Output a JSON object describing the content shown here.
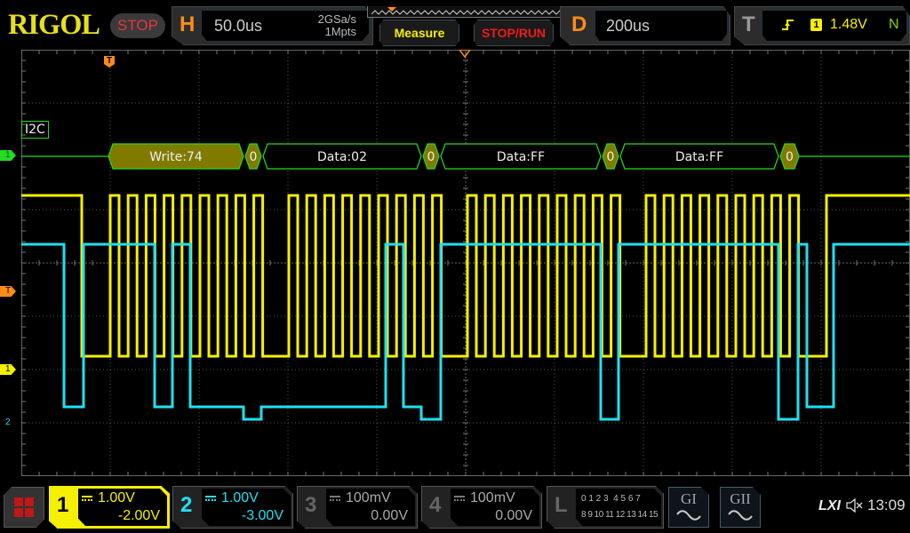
{
  "header": {
    "brand": "RIGOL",
    "run_state": "STOP",
    "horizontal": {
      "letter": "H",
      "timebase": "50.0us",
      "sample_rate": "2GSa/s",
      "memory_depth": "1Mpts"
    },
    "measure_label": "Measure",
    "stop_run_label": "STOP/RUN",
    "delay": {
      "letter": "D",
      "value": "200us"
    },
    "trigger": {
      "letter": "T",
      "edge": "rising-edge-icon",
      "source": "1",
      "level": "1.48V",
      "mode": "N"
    }
  },
  "decoder": {
    "label": "I2C",
    "packets": [
      {
        "text": "Write:74",
        "type": "address"
      },
      {
        "text": "0",
        "type": "ack"
      },
      {
        "text": "Data:02",
        "type": "data"
      },
      {
        "text": "0",
        "type": "ack"
      },
      {
        "text": "Data:FF",
        "type": "data"
      },
      {
        "text": "0",
        "type": "ack"
      },
      {
        "text": "Data:FF",
        "type": "data"
      },
      {
        "text": "0",
        "type": "ack"
      }
    ]
  },
  "markers": {
    "bus": "1",
    "trigger_level": "T",
    "ch1": "1",
    "ch2": "2",
    "trigger_pos": "T"
  },
  "colors": {
    "ch1": "#f5f000",
    "ch2": "#20e0f0",
    "bus": "#22dd22",
    "trigger": "#ff8c1a",
    "grid": "#555555",
    "packet_fill": "#807a00"
  },
  "channels": [
    {
      "num": "1",
      "scale": "1.00V",
      "offset": "-2.00V",
      "active": true
    },
    {
      "num": "2",
      "scale": "1.00V",
      "offset": "-3.00V",
      "active": false
    },
    {
      "num": "3",
      "scale": "100mV",
      "offset": "0.00V",
      "active": false
    },
    {
      "num": "4",
      "scale": "100mV",
      "offset": "0.00V",
      "active": false
    }
  ],
  "logic": {
    "letter": "L",
    "row1": "0 1 2 3  4 5 6 7",
    "row2": "8 9 10 11 12 13 14 15"
  },
  "generators": [
    {
      "label": "GI"
    },
    {
      "label": "GII"
    }
  ],
  "status": {
    "lxi": "LXI",
    "speaker": "muted",
    "time": "13:09"
  }
}
